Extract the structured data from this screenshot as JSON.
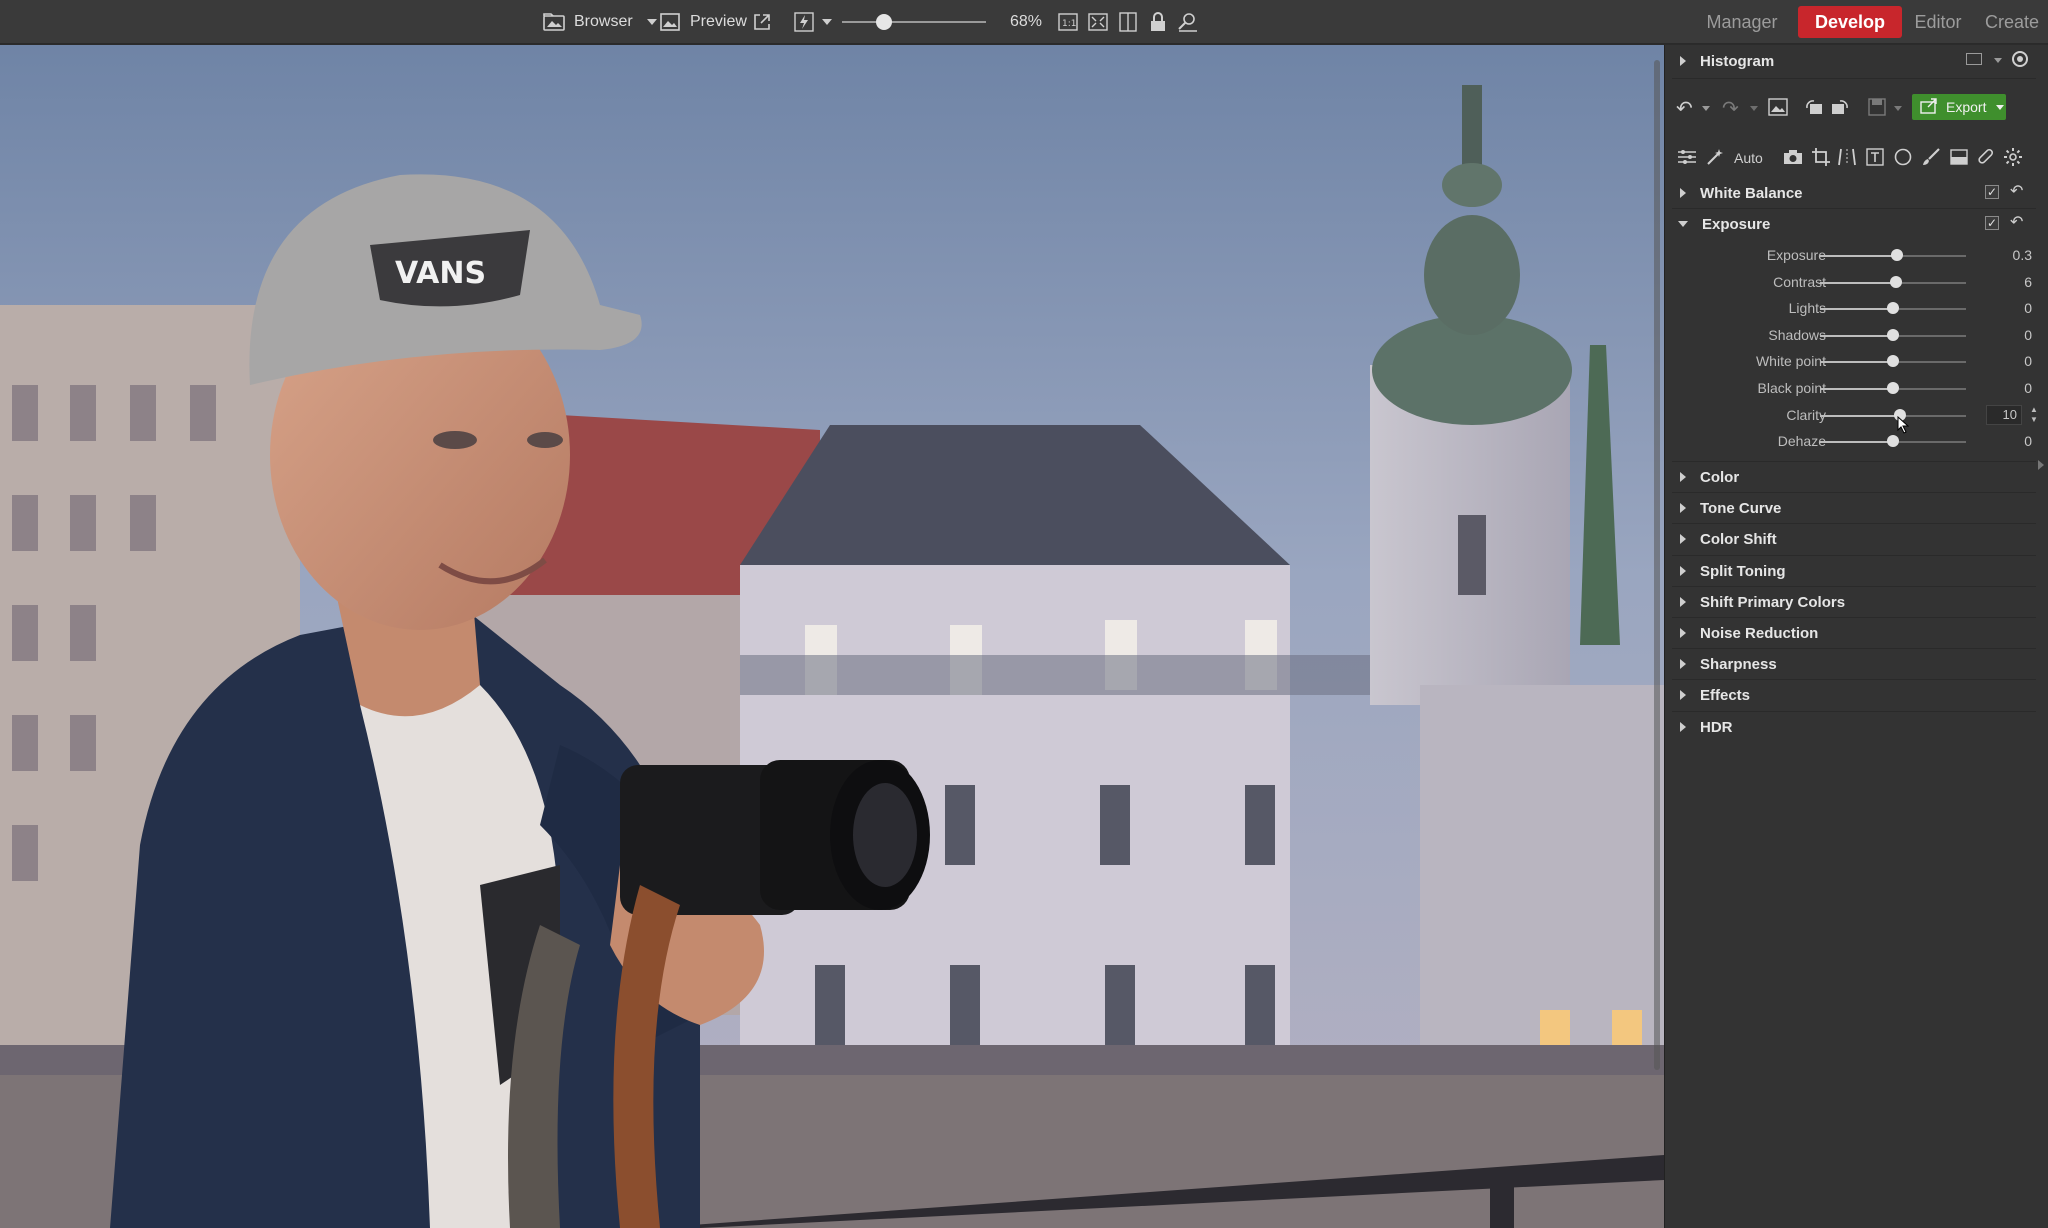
{
  "toolbar": {
    "browser_label": "Browser",
    "preview_label": "Preview",
    "zoom_level": "68%",
    "zoom_fraction": 0.29
  },
  "modes": {
    "manager": "Manager",
    "develop": "Develop",
    "editor": "Editor",
    "create": "Create",
    "active": "Develop"
  },
  "panel": {
    "histogram_label": "Histogram",
    "export_label": "Export",
    "auto_label": "Auto",
    "white_balance": {
      "title": "White Balance",
      "checked": true
    },
    "exposure": {
      "title": "Exposure",
      "checked": true,
      "sliders": [
        {
          "label": "Exposure",
          "value": "0.3",
          "fraction": 0.53
        },
        {
          "label": "Contrast",
          "value": "6",
          "fraction": 0.52
        },
        {
          "label": "Lights",
          "value": "0",
          "fraction": 0.5
        },
        {
          "label": "Shadows",
          "value": "0",
          "fraction": 0.5
        },
        {
          "label": "White point",
          "value": "0",
          "fraction": 0.5
        },
        {
          "label": "Black point",
          "value": "0",
          "fraction": 0.5
        },
        {
          "label": "Clarity",
          "value": "10",
          "fraction": 0.55
        },
        {
          "label": "Dehaze",
          "value": "0",
          "fraction": 0.5
        }
      ]
    },
    "sections": [
      "Color",
      "Tone Curve",
      "Color Shift",
      "Split Toning",
      "Shift Primary Colors",
      "Noise Reduction",
      "Sharpness",
      "Effects",
      "HDR"
    ]
  },
  "icons": {
    "browser": "folder-image-icon",
    "preview": "image-icon",
    "external": "open-external-icon",
    "flash": "flash-icon",
    "fit": "fit-window-icon",
    "fullscreen": "fullscreen-icon",
    "compare": "compare-icon",
    "lock": "lock-icon",
    "search": "search-person-icon"
  },
  "colors": {
    "accent": "#c8262c",
    "export_green": "#3f8f2d",
    "panel_bg": "#333333",
    "topbar_bg": "#3a3a3a"
  }
}
